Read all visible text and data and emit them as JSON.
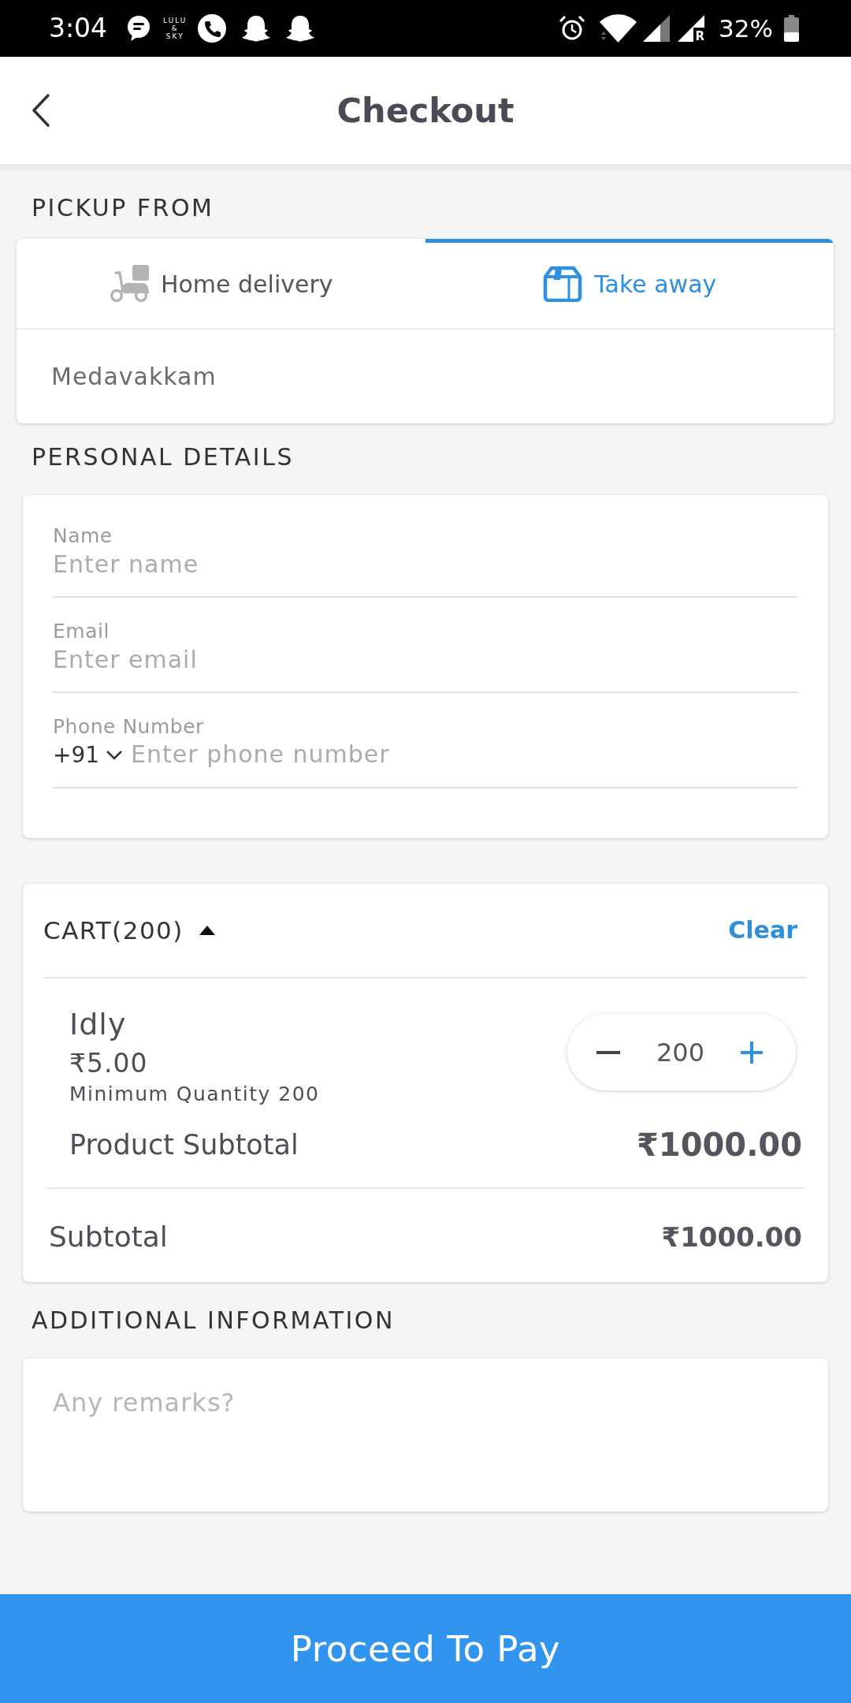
{
  "status_bar": {
    "time": "3:04",
    "app_label_lines": [
      "LULU",
      "&",
      "SKY"
    ],
    "roaming_mark": "R",
    "battery": "32%"
  },
  "header": {
    "title": "Checkout"
  },
  "pickup": {
    "label": "PICKUP FROM",
    "tabs": [
      {
        "kind": "delivery",
        "label": "Home delivery",
        "selected": false
      },
      {
        "kind": "takeaway",
        "label": "Take away",
        "selected": true
      }
    ],
    "location": "Medavakkam"
  },
  "personal_details": {
    "label": "PERSONAL DETAILS",
    "fields": [
      {
        "kind": "text",
        "label": "Name",
        "placeholder": "Enter name"
      },
      {
        "kind": "text",
        "label": "Email",
        "placeholder": "Enter email"
      },
      {
        "kind": "phone",
        "label": "Phone Number",
        "country_code": "+91",
        "placeholder": "Enter phone number"
      }
    ]
  },
  "cart": {
    "title": "CART(200)",
    "expanded": true,
    "clear": "Clear",
    "items": [
      {
        "name": "Idly",
        "price": "₹5.00",
        "note": "Minimum Quantity 200",
        "quantity": "200",
        "subtotal_label": "Product Subtotal",
        "subtotal": "₹1000.00"
      }
    ],
    "subtotal_label": "Subtotal",
    "subtotal": "₹1000.00"
  },
  "additional_information": {
    "label": "ADDITIONAL INFORMATION",
    "placeholder": "Any remarks?"
  },
  "proceed_button": {
    "label": "Proceed To Pay"
  }
}
